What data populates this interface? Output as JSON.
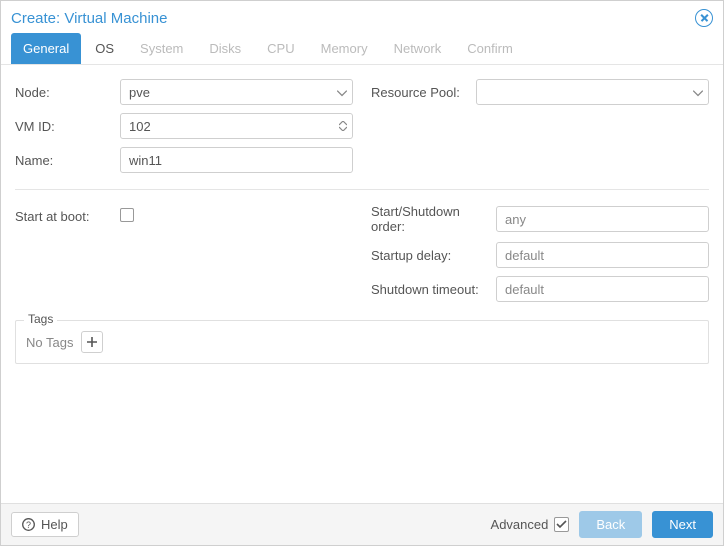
{
  "window": {
    "title": "Create: Virtual Machine"
  },
  "tabs": {
    "general": "General",
    "os": "OS",
    "system": "System",
    "disks": "Disks",
    "cpu": "CPU",
    "memory": "Memory",
    "network": "Network",
    "confirm": "Confirm"
  },
  "form": {
    "node": {
      "label": "Node:",
      "value": "pve"
    },
    "vmid": {
      "label": "VM ID:",
      "value": "102"
    },
    "name": {
      "label": "Name:",
      "value": "win11"
    },
    "resource_pool": {
      "label": "Resource Pool:",
      "value": ""
    },
    "start_at_boot": {
      "label": "Start at boot:"
    },
    "start_order": {
      "label": "Start/Shutdown order:",
      "placeholder": "any"
    },
    "startup_delay": {
      "label": "Startup delay:",
      "placeholder": "default"
    },
    "shutdown_timeout": {
      "label": "Shutdown timeout:",
      "placeholder": "default"
    }
  },
  "tags": {
    "legend": "Tags",
    "empty": "No Tags"
  },
  "footer": {
    "help": "Help",
    "advanced": "Advanced",
    "back": "Back",
    "next": "Next"
  }
}
